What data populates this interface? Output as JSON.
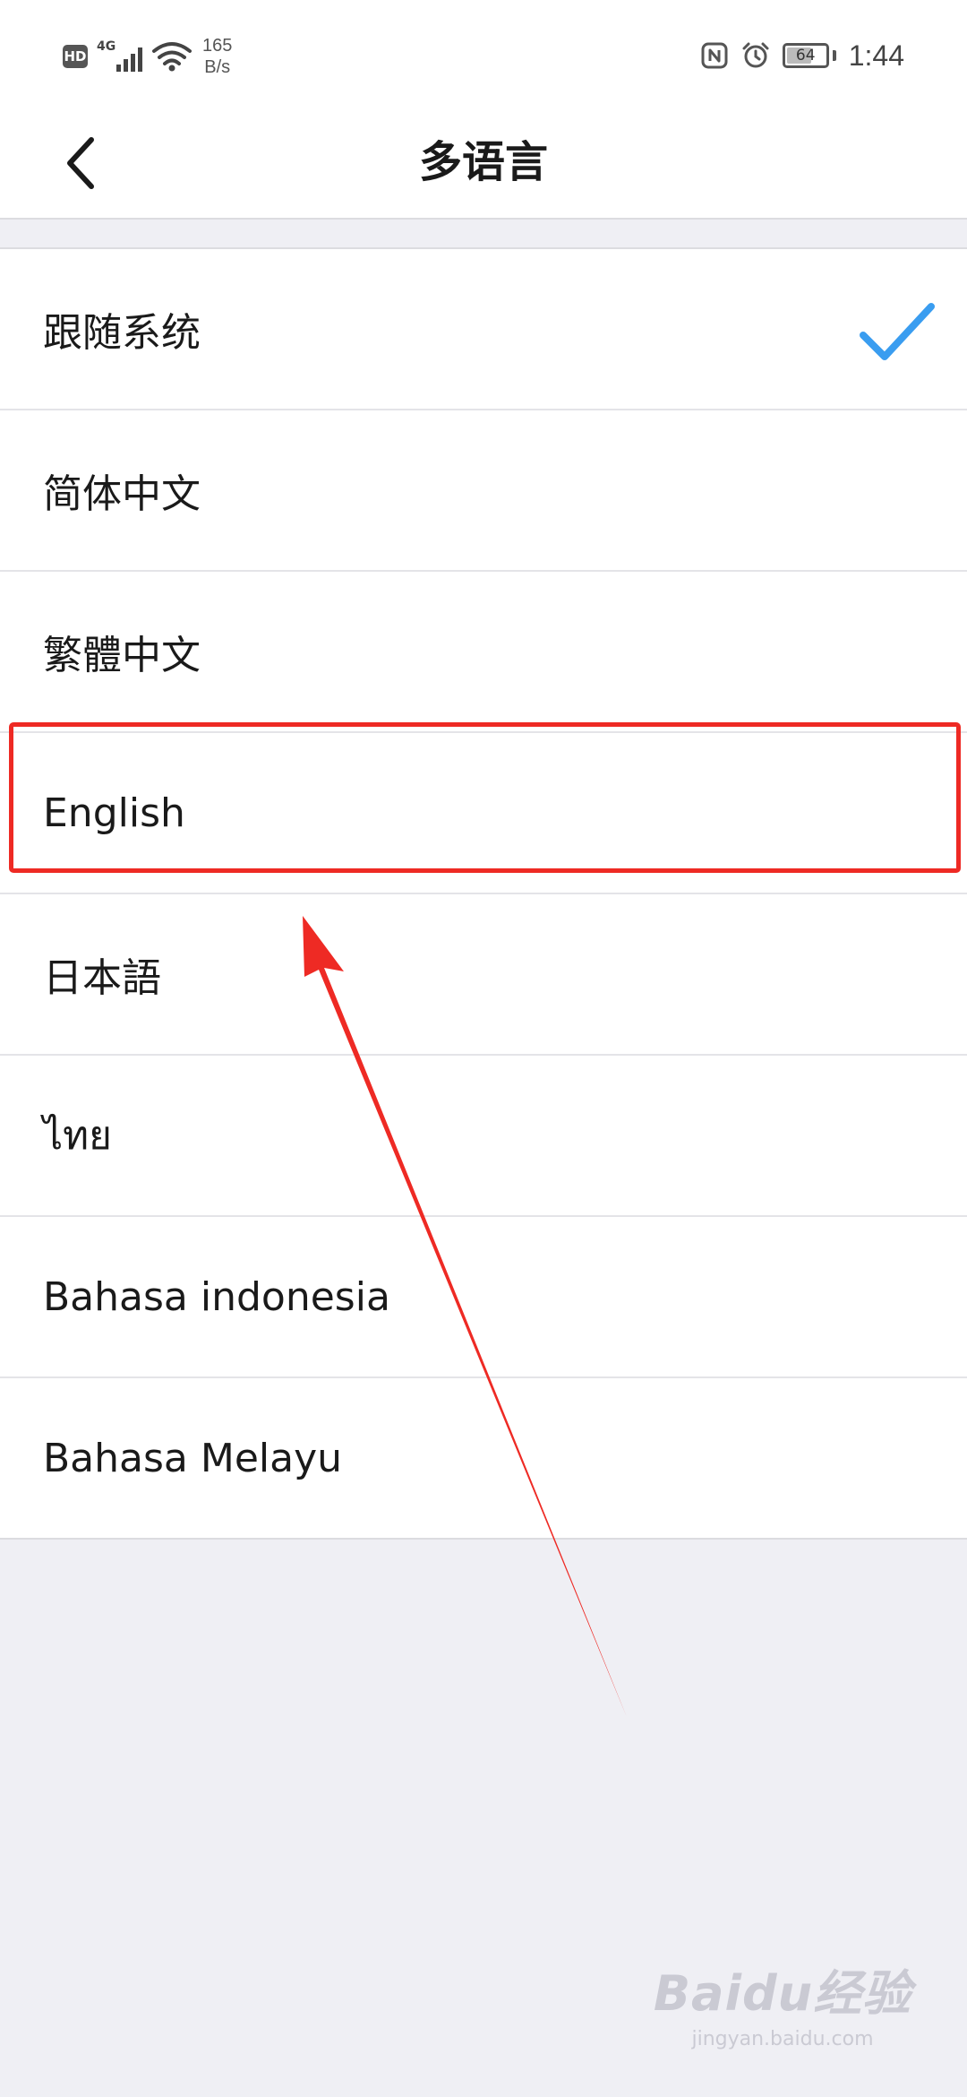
{
  "status_bar": {
    "hd_badge": "HD",
    "network_type": "4G",
    "net_speed_value": "165",
    "net_speed_unit": "B/s",
    "battery_level": "64",
    "battery_fraction": 0.64,
    "time": "1:44",
    "icons": [
      "hd-icon",
      "signal-icon",
      "wifi-icon",
      "nfc-icon",
      "alarm-icon",
      "battery-icon"
    ]
  },
  "header": {
    "title": "多语言",
    "back_icon": "chevron-left-icon"
  },
  "languages": [
    {
      "label": "跟随系统",
      "selected": true
    },
    {
      "label": "简体中文",
      "selected": false
    },
    {
      "label": "繁體中文",
      "selected": false
    },
    {
      "label": "English",
      "selected": false
    },
    {
      "label": "日本語",
      "selected": false
    },
    {
      "label": "ไทย",
      "selected": false
    },
    {
      "label": "Bahasa indonesia",
      "selected": false
    },
    {
      "label": "Bahasa Melayu",
      "selected": false
    }
  ],
  "selected_icon": "checkmark-icon",
  "colors": {
    "accent": "#3a9df0",
    "annotation": "#ee2a24",
    "background": "#efeff4"
  },
  "watermark": {
    "logo": "Baidu经验",
    "sub": "jingyan.baidu.com"
  }
}
